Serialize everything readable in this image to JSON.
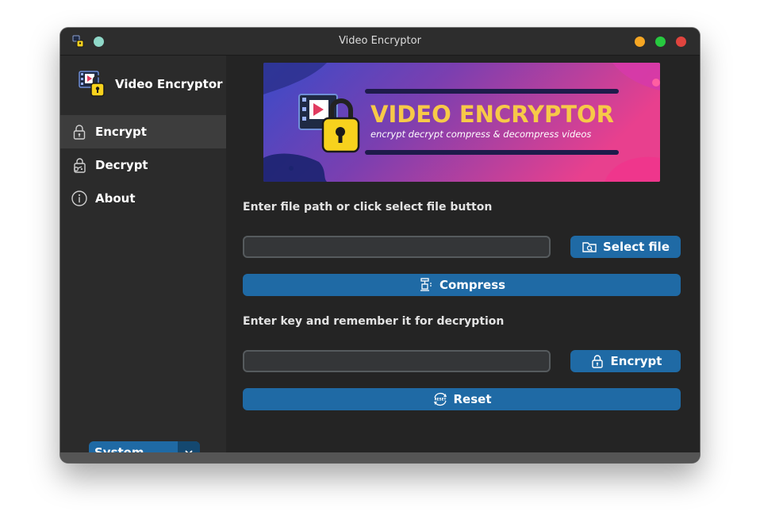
{
  "window": {
    "title": "Video Encryptor",
    "controls": {
      "minimize_color": "#f5a623",
      "maximize_color": "#27c93f",
      "close_color": "#e0443e"
    }
  },
  "sidebar": {
    "app_name": "Video Encryptor",
    "items": [
      {
        "label": "Encrypt",
        "icon": "lock-icon",
        "active": true
      },
      {
        "label": "Decrypt",
        "icon": "unlock-icon",
        "active": false
      },
      {
        "label": "About",
        "icon": "info-icon",
        "active": false
      }
    ],
    "appearance_mode": {
      "value": "System"
    }
  },
  "banner": {
    "title": "VIDEO ENCRYPTOR",
    "subtitle": "encrypt decrypt compress & decompress videos"
  },
  "main": {
    "file_prompt": "Enter file path or click select file button",
    "file_path_value": "",
    "select_file_label": "Select file",
    "compress_label": "Compress",
    "key_prompt": "Enter key and remember it for decryption",
    "key_value": "",
    "encrypt_label": "Encrypt",
    "reset_label": "Reset",
    "reset_icon_text": "RESET"
  },
  "colors": {
    "accent": "#1f6aa5",
    "accent_dark": "#144870",
    "sidebar_bg": "#2b2b2b",
    "main_bg": "#242424"
  }
}
